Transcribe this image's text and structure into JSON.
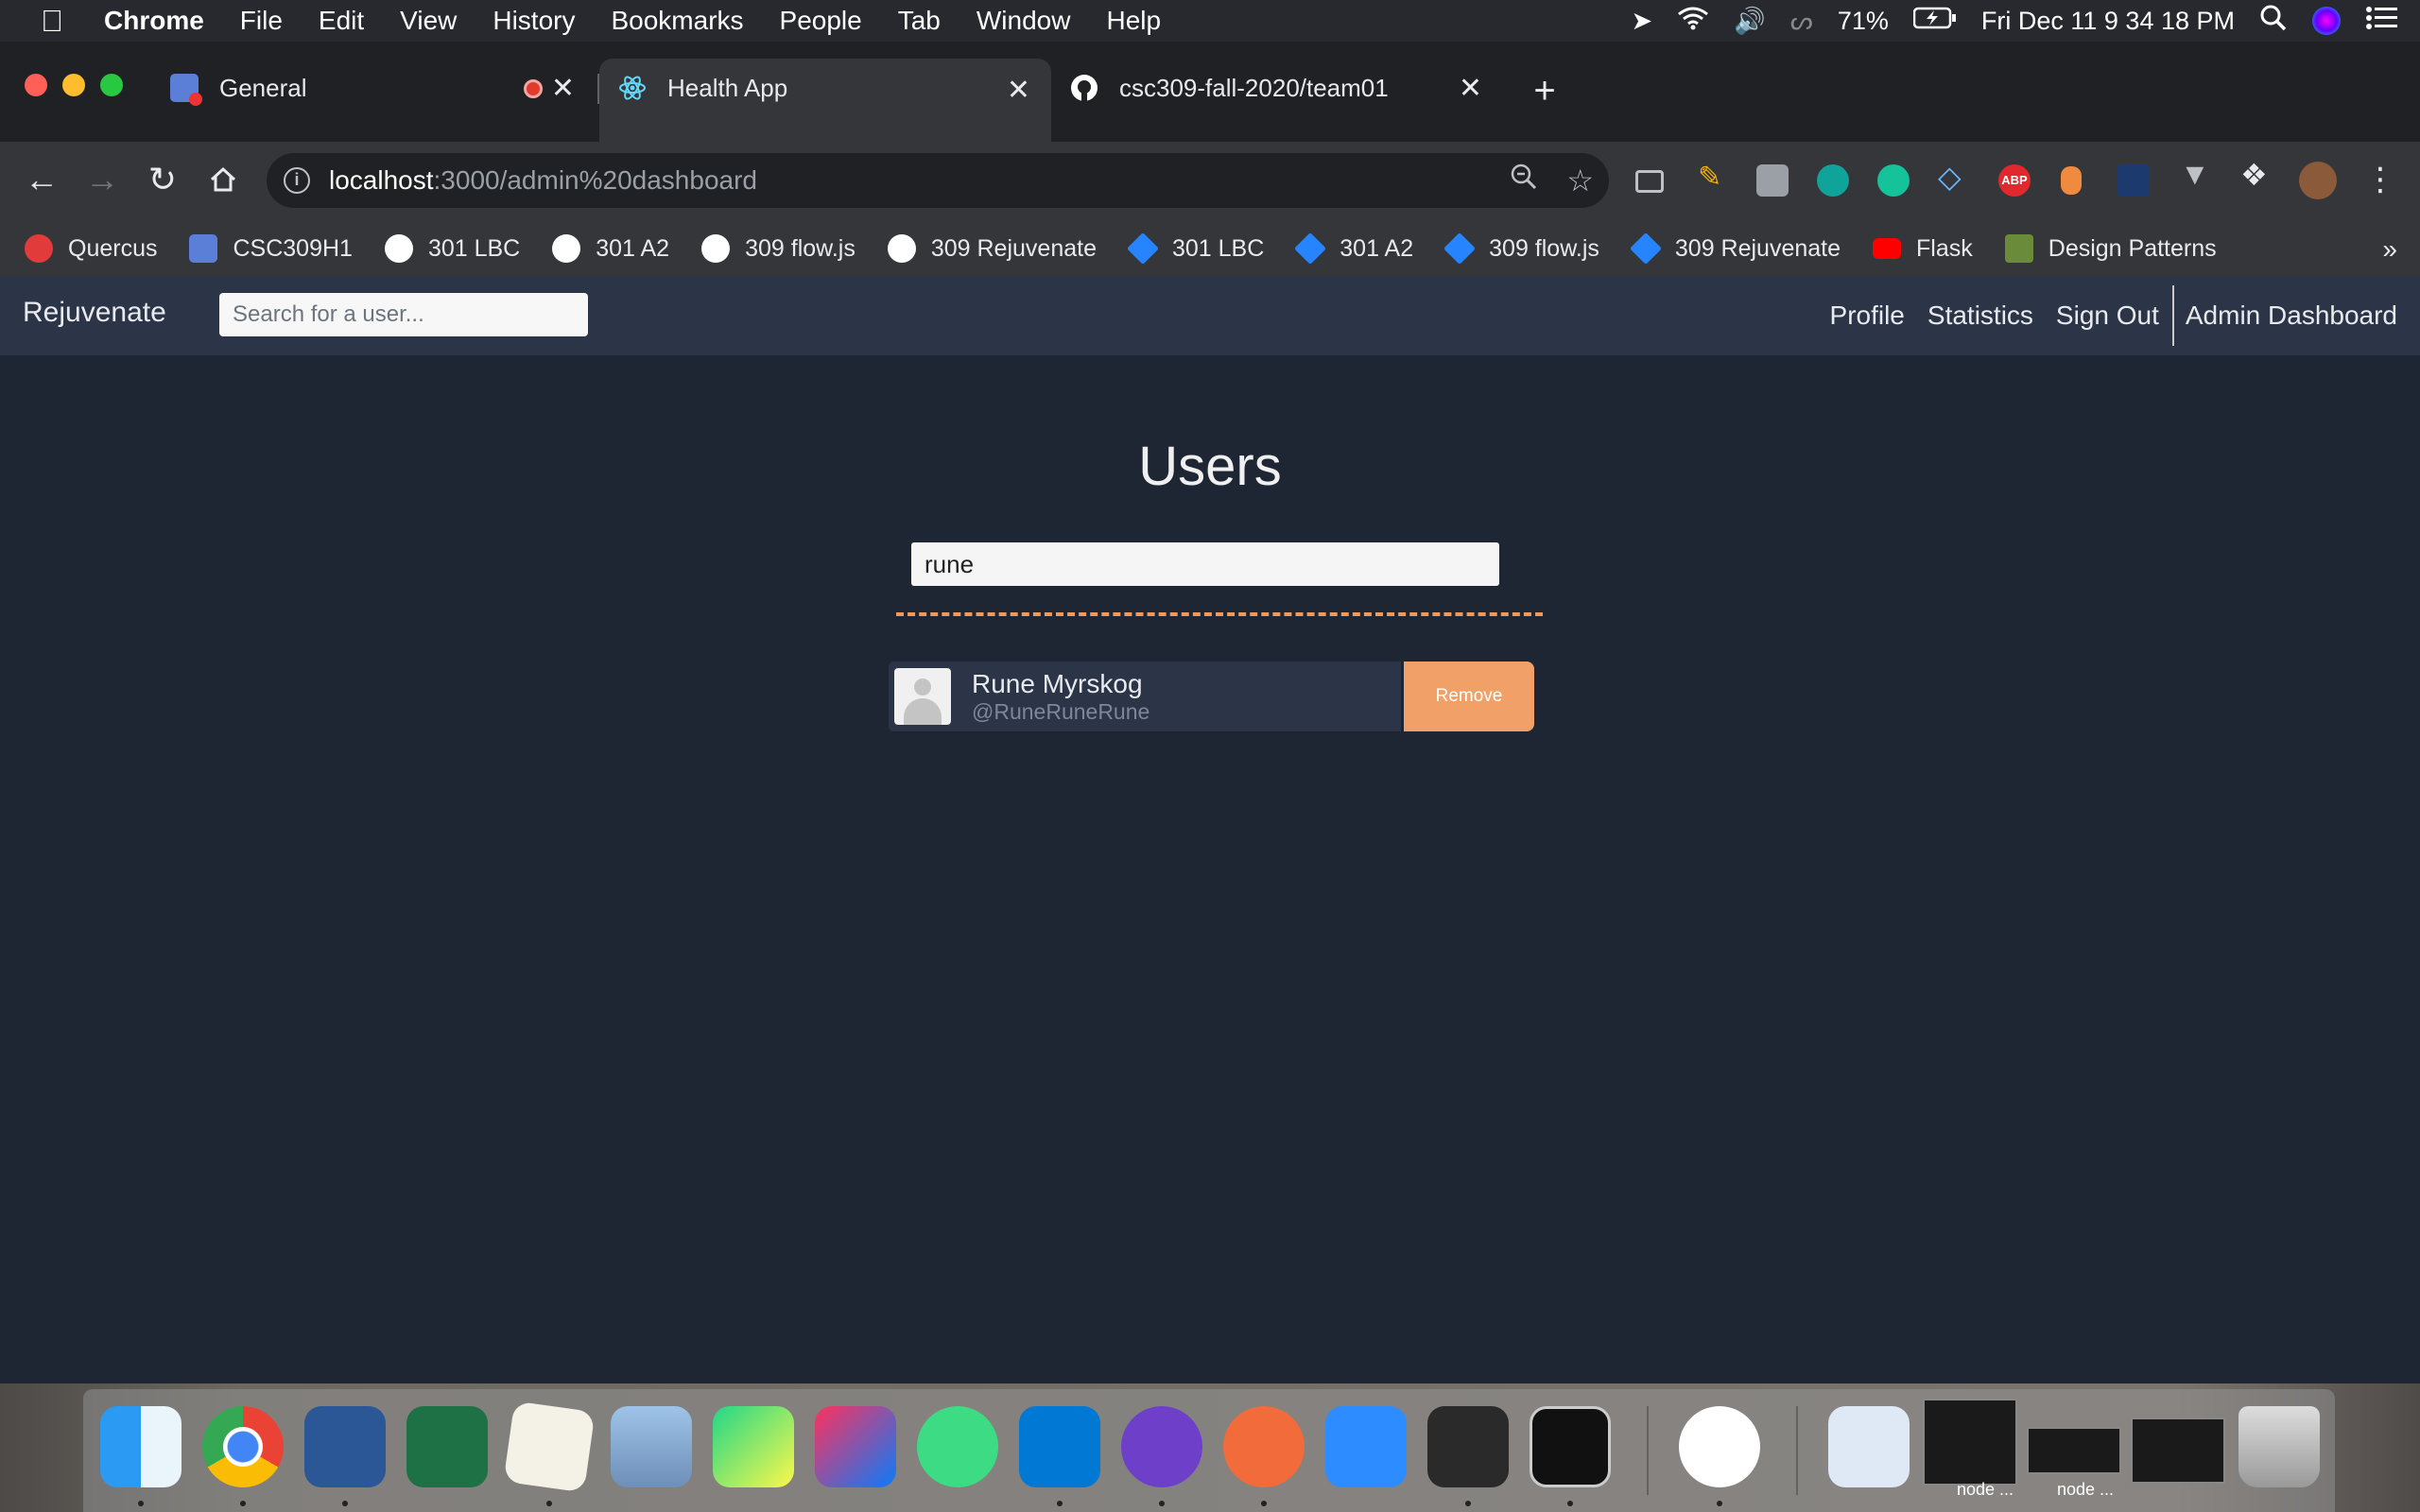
{
  "menubar": {
    "app_name": "Chrome",
    "items": [
      "File",
      "Edit",
      "View",
      "History",
      "Bookmarks",
      "People",
      "Tab",
      "Window",
      "Help"
    ],
    "battery": "71%",
    "clock": "Fri Dec 11  9 34 18 PM"
  },
  "tabs": [
    {
      "title": "General"
    },
    {
      "title": "Health App"
    },
    {
      "title": "csc309-fall-2020/team01"
    }
  ],
  "omnibox": {
    "host": "localhost",
    "path": ":3000/admin%20dashboard"
  },
  "bookmarks": [
    {
      "label": "Quercus",
      "icon": "quercus-icon"
    },
    {
      "label": "CSC309H1",
      "icon": "webex-icon"
    },
    {
      "label": "301 LBC",
      "icon": "github-icon"
    },
    {
      "label": "301 A2",
      "icon": "github-icon"
    },
    {
      "label": "309 flow.js",
      "icon": "github-icon"
    },
    {
      "label": "309 Rejuvenate",
      "icon": "github-icon"
    },
    {
      "label": "301 LBC",
      "icon": "jira-icon"
    },
    {
      "label": "301 A2",
      "icon": "jira-icon"
    },
    {
      "label": "309 flow.js",
      "icon": "jira-icon"
    },
    {
      "label": "309 Rejuvenate",
      "icon": "jira-icon"
    },
    {
      "label": "Flask",
      "icon": "youtube-icon"
    },
    {
      "label": "Design Patterns",
      "icon": "refactoring-icon"
    }
  ],
  "app": {
    "brand": "Rejuvenate",
    "search_placeholder": "Search for a user...",
    "nav": {
      "profile": "Profile",
      "statistics": "Statistics",
      "sign_out": "Sign Out",
      "admin_dashboard": "Admin Dashboard"
    },
    "title": "Users",
    "filter_value": "rune",
    "users": [
      {
        "name": "Rune Myrskog",
        "handle": "@RuneRuneRune",
        "action": "Remove"
      }
    ]
  },
  "dock": {
    "window_labels": [
      "node ...",
      "node ..."
    ]
  },
  "colors": {
    "page_bg": "#1f2633",
    "navbar_bg": "#2c3548",
    "accent_orange": "#f1a068",
    "dashed_line": "#f0995a"
  }
}
